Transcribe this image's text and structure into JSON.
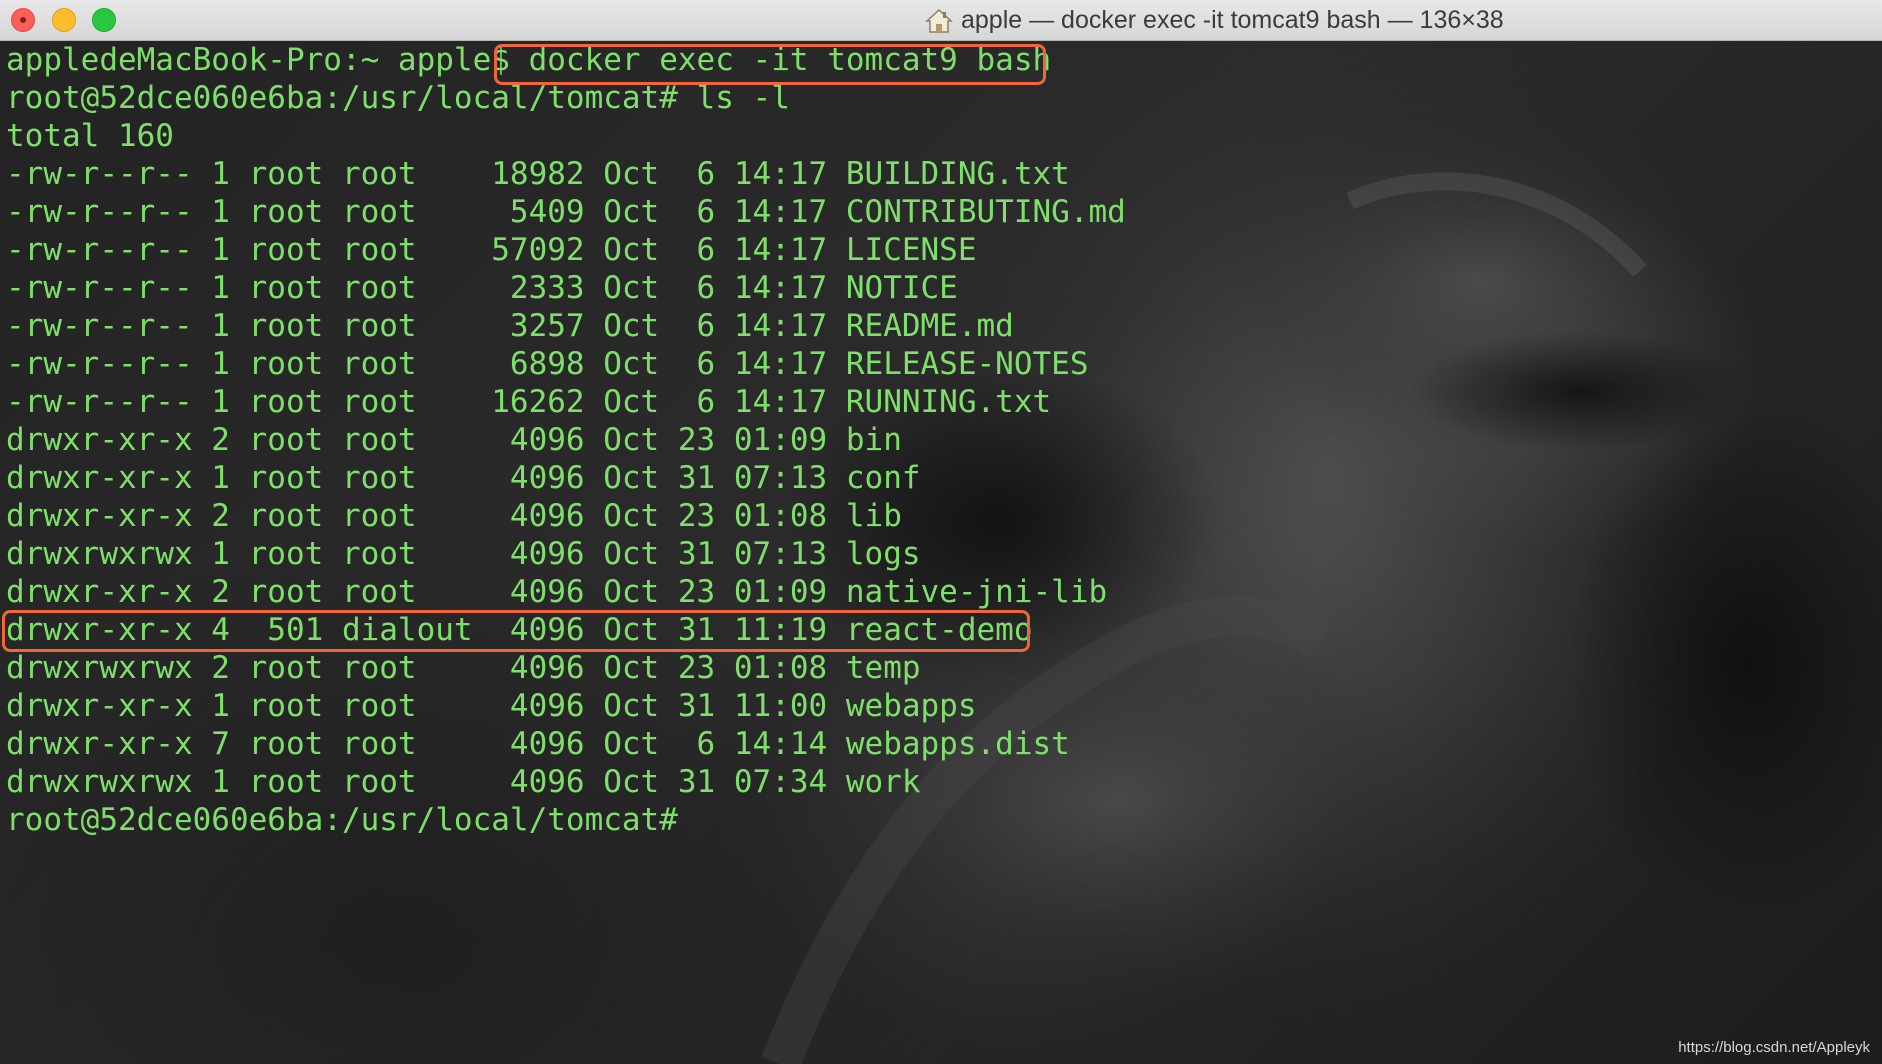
{
  "window": {
    "title": "apple — docker exec -it tomcat9 bash — 136×38",
    "title_icon": "home-icon",
    "buttons": [
      "close",
      "minimize",
      "zoom"
    ]
  },
  "terminal": {
    "colors": {
      "text": "#7ee06a",
      "highlight_border": "#f2643a",
      "titlebar": "#e0e0e0"
    },
    "lines": [
      "appledeMacBook-Pro:~ apple$ docker exec -it tomcat9 bash",
      "root@52dce060e6ba:/usr/local/tomcat# ls -l",
      "total 160",
      "-rw-r--r-- 1 root root    18982 Oct  6 14:17 BUILDING.txt",
      "-rw-r--r-- 1 root root     5409 Oct  6 14:17 CONTRIBUTING.md",
      "-rw-r--r-- 1 root root    57092 Oct  6 14:17 LICENSE",
      "-rw-r--r-- 1 root root     2333 Oct  6 14:17 NOTICE",
      "-rw-r--r-- 1 root root     3257 Oct  6 14:17 README.md",
      "-rw-r--r-- 1 root root     6898 Oct  6 14:17 RELEASE-NOTES",
      "-rw-r--r-- 1 root root    16262 Oct  6 14:17 RUNNING.txt",
      "drwxr-xr-x 2 root root     4096 Oct 23 01:09 bin",
      "drwxr-xr-x 1 root root     4096 Oct 31 07:13 conf",
      "drwxr-xr-x 2 root root     4096 Oct 23 01:08 lib",
      "drwxrwxrwx 1 root root     4096 Oct 31 07:13 logs",
      "drwxr-xr-x 2 root root     4096 Oct 23 01:09 native-jni-lib",
      "drwxr-xr-x 4  501 dialout  4096 Oct 31 11:19 react-demo",
      "drwxrwxrwx 2 root root     4096 Oct 23 01:08 temp",
      "drwxr-xr-x 1 root root     4096 Oct 31 11:00 webapps",
      "drwxr-xr-x 7 root root     4096 Oct  6 14:14 webapps.dist",
      "drwxrwxrwx 1 root root     4096 Oct 31 07:34 work",
      "root@52dce060e6ba:/usr/local/tomcat# "
    ]
  },
  "watermark": "https://blog.csdn.net/Appleyk"
}
